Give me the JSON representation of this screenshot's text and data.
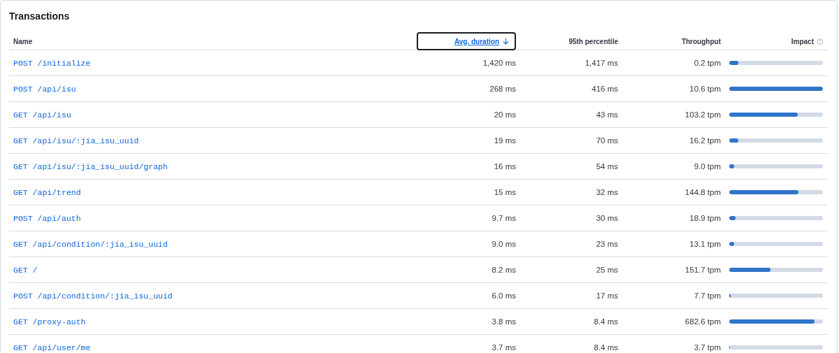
{
  "title": "Transactions",
  "columns": [
    {
      "label": "Name",
      "sorted": false,
      "info": false
    },
    {
      "label": "Avg. duration",
      "sorted": true,
      "info": false
    },
    {
      "label": "95th percentile",
      "sorted": false,
      "info": false
    },
    {
      "label": "Throughput",
      "sorted": false,
      "info": false
    },
    {
      "label": "Impact",
      "sorted": false,
      "info": true
    }
  ],
  "rows": [
    {
      "name": "POST /initialize",
      "avg": "1,420 ms",
      "p95": "1,417 ms",
      "throughput": "0.2 tpm",
      "level": 0.1
    },
    {
      "name": "POST /api/isu",
      "avg": "268 ms",
      "p95": "416 ms",
      "throughput": "10.6 tpm",
      "level": 1.0
    },
    {
      "name": "GET /api/isu",
      "avg": "20 ms",
      "p95": "43 ms",
      "throughput": "103.2 tpm",
      "level": 0.73
    },
    {
      "name": "GET /api/isu/:jia_isu_uuid",
      "avg": "19 ms",
      "p95": "70 ms",
      "throughput": "16.2 tpm",
      "level": 0.1
    },
    {
      "name": "GET /api/isu/:jia_isu_uuid/graph",
      "avg": "16 ms",
      "p95": "54 ms",
      "throughput": "9.0 tpm",
      "level": 0.05
    },
    {
      "name": "GET /api/trend",
      "avg": "15 ms",
      "p95": "32 ms",
      "throughput": "144.8 tpm",
      "level": 0.74
    },
    {
      "name": "POST /api/auth",
      "avg": "9.7 ms",
      "p95": "30 ms",
      "throughput": "18.9 tpm",
      "level": 0.07
    },
    {
      "name": "GET /api/condition/:jia_isu_uuid",
      "avg": "9.0 ms",
      "p95": "23 ms",
      "throughput": "13.1 tpm",
      "level": 0.05
    },
    {
      "name": "GET /",
      "avg": "8.2 ms",
      "p95": "25 ms",
      "throughput": "151.7 tpm",
      "level": 0.44
    },
    {
      "name": "POST /api/condition/:jia_isu_uuid",
      "avg": "6.0 ms",
      "p95": "17 ms",
      "throughput": "7.7 tpm",
      "level": 0.015
    },
    {
      "name": "GET /proxy-auth",
      "avg": "3.8 ms",
      "p95": "8.4 ms",
      "throughput": "682.6 tpm",
      "level": 0.91
    },
    {
      "name": "GET /api/user/me",
      "avg": "3.7 ms",
      "p95": "8.4 ms",
      "throughput": "3.7 tpm",
      "level": 0.01
    }
  ]
}
